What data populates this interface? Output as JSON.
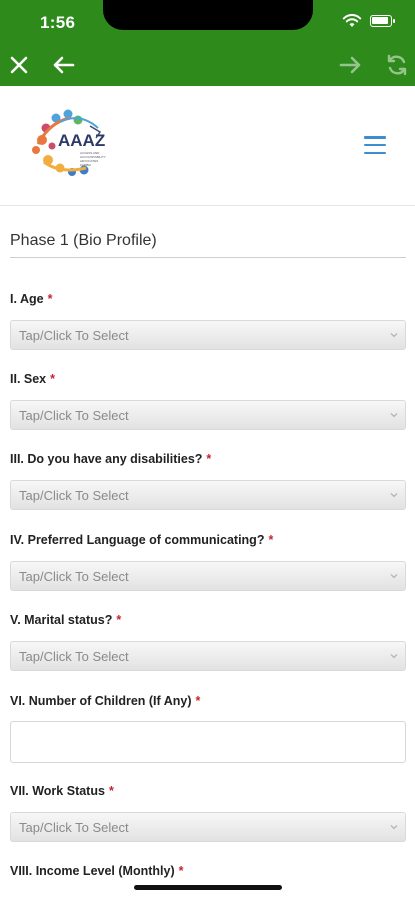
{
  "status_bar": {
    "time": "1:56"
  },
  "logo": {
    "text": "AAAZ",
    "tagline": "ACCESS AND ACCOUNTABILITY ADVOCATES ZAMBIA"
  },
  "form": {
    "phase_title": "Phase 1 (Bio Profile)",
    "required_mark": "*",
    "questions": [
      {
        "label": "I. Age",
        "type": "select",
        "value": "Tap/Click To Select"
      },
      {
        "label": "II. Sex",
        "type": "select",
        "value": "Tap/Click To Select"
      },
      {
        "label": "III. Do you have any disabilities?",
        "type": "select",
        "value": "Tap/Click To Select"
      },
      {
        "label": "IV. Preferred Language of communicating?",
        "type": "select",
        "value": "Tap/Click To Select"
      },
      {
        "label": "V. Marital status?",
        "type": "select",
        "value": "Tap/Click To Select"
      },
      {
        "label": "VI. Number of Children (If Any)",
        "type": "text",
        "value": ""
      },
      {
        "label": "VII. Work Status",
        "type": "select",
        "value": "Tap/Click To Select"
      },
      {
        "label": "VIII. Income Level (Monthly)",
        "type": "select",
        "value": ""
      }
    ]
  },
  "colors": {
    "toolbar": "#2d8a1b",
    "required": "#c0282d",
    "menu": "#3e8ecf"
  }
}
